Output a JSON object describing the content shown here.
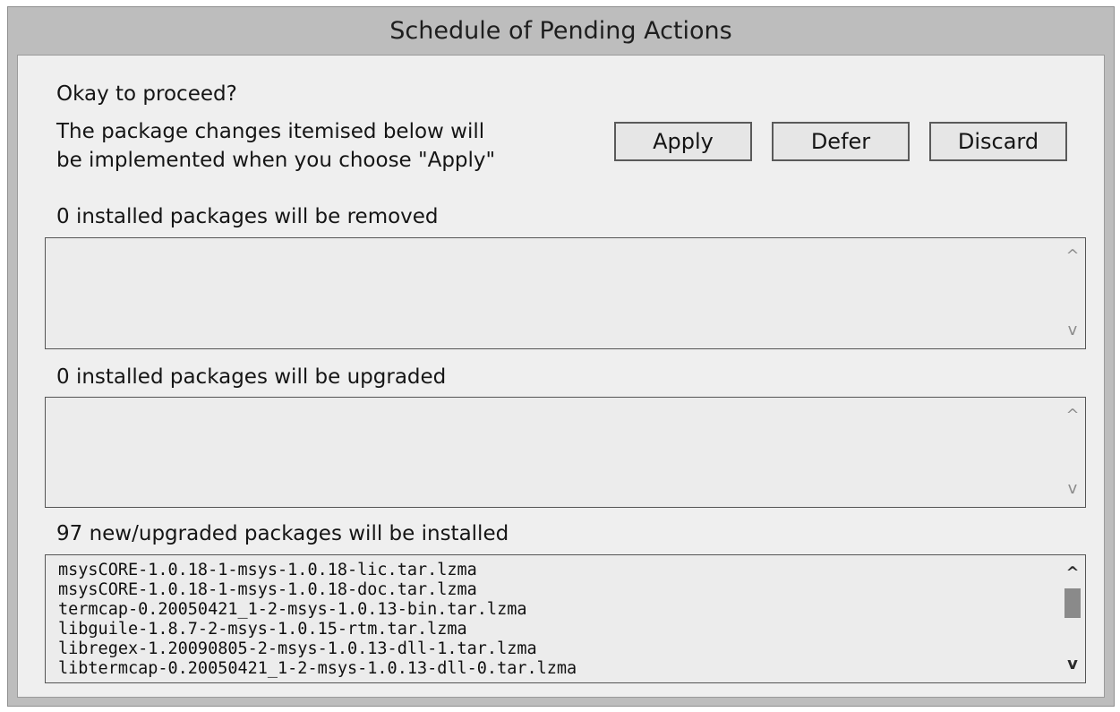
{
  "window": {
    "title": "Schedule of Pending Actions"
  },
  "prompt": {
    "heading": "Okay to proceed?",
    "message": "The package changes itemised below will\nbe implemented when you choose \"Apply\""
  },
  "buttons": {
    "apply": "Apply",
    "defer": "Defer",
    "discard": "Discard"
  },
  "sections": {
    "removed": {
      "label": "0 installed packages will be removed",
      "items": []
    },
    "upgraded": {
      "label": "0 installed packages will be upgraded",
      "items": []
    },
    "installed": {
      "label": "97 new/upgraded packages will be installed",
      "items": [
        "msysCORE-1.0.18-1-msys-1.0.18-lic.tar.lzma",
        "msysCORE-1.0.18-1-msys-1.0.18-doc.tar.lzma",
        "termcap-0.20050421_1-2-msys-1.0.13-bin.tar.lzma",
        "libguile-1.8.7-2-msys-1.0.15-rtm.tar.lzma",
        "libregex-1.20090805-2-msys-1.0.13-dll-1.tar.lzma",
        "libtermcap-0.20050421_1-2-msys-1.0.13-dll-0.tar.lzma"
      ]
    }
  },
  "icons": {
    "scroll_up": "^",
    "scroll_down": "v",
    "scroll_up_active": "^",
    "scroll_down_active": "v"
  }
}
